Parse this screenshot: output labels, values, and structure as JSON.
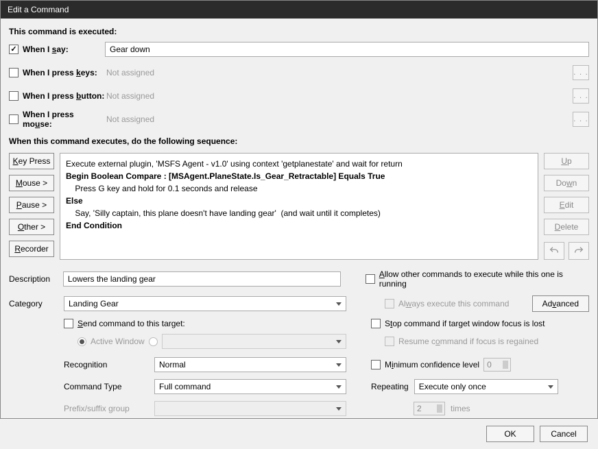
{
  "title": "Edit a Command",
  "triggers": {
    "heading": "This command is executed:",
    "say": {
      "label": "When I say:",
      "checked": true,
      "value": "Gear down"
    },
    "keys": {
      "label": "When I press keys:",
      "checked": false,
      "value": "Not assigned"
    },
    "button": {
      "label": "When I press button:",
      "checked": false,
      "value": "Not assigned"
    },
    "mouse": {
      "label": "When I press mouse:",
      "checked": false,
      "value": "Not assigned"
    }
  },
  "sequence": {
    "heading": "When this command executes, do the following sequence:",
    "buttons": {
      "keypress": "Key Press",
      "mouse": "Mouse >",
      "pause": "Pause >",
      "other": "Other >",
      "recorder": "Recorder"
    },
    "right_buttons": {
      "up": "Up",
      "down": "Down",
      "edit": "Edit",
      "delete": "Delete"
    },
    "lines": [
      {
        "text": "Execute external plugin, 'MSFS Agent - v1.0' using context 'getplanestate' and wait for return",
        "indent": 0,
        "bold": false
      },
      {
        "text": "Begin Boolean Compare : [MSAgent.PlaneState.Is_Gear_Retractable] Equals True",
        "indent": 0,
        "bold": true
      },
      {
        "text": "Press G key and hold for 0.1 seconds and release",
        "indent": 1,
        "bold": false
      },
      {
        "text": "Else",
        "indent": 0,
        "bold": true
      },
      {
        "text": "Say, 'Silly captain, this plane doesn't have landing gear'  (and wait until it completes)",
        "indent": 1,
        "bold": false
      },
      {
        "text": "End Condition",
        "indent": 0,
        "bold": true
      }
    ]
  },
  "fields": {
    "description_label": "Description",
    "description_value": "Lowers the landing gear",
    "category_label": "Category",
    "category_value": "Landing Gear",
    "allow_other": "Allow other commands to execute while this one is running",
    "always_execute": "Always execute this command",
    "advanced": "Advanced",
    "send_target": "Send command to this target:",
    "active_window": "Active Window",
    "stop_focus": "Stop command if target window focus is lost",
    "resume_focus": "Resume command if focus is regained",
    "recognition_label": "Recognition",
    "recognition_value": "Normal",
    "min_conf": "Minimum confidence level",
    "min_conf_value": "0",
    "cmdtype_label": "Command Type",
    "cmdtype_value": "Full command",
    "repeating_label": "Repeating",
    "repeating_value": "Execute only once",
    "prefix_label": "Prefix/suffix group",
    "times_value": "2",
    "times_label": "times"
  },
  "footer": {
    "ok": "OK",
    "cancel": "Cancel"
  }
}
